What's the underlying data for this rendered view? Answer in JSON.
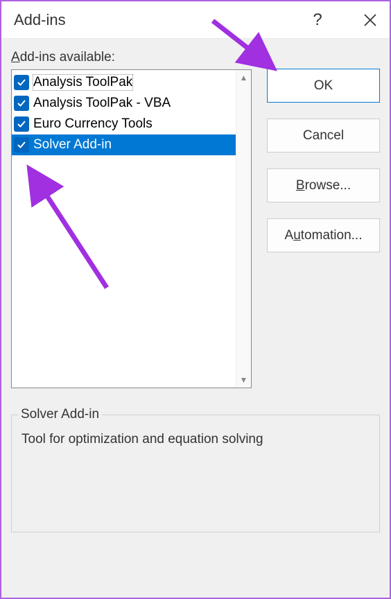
{
  "dialog": {
    "title": "Add-ins",
    "list_label_prefix": "A",
    "list_label_rest": "dd-ins available:",
    "items": [
      {
        "label": "Analysis ToolPak",
        "checked": true,
        "selected": false,
        "first": true
      },
      {
        "label": "Analysis ToolPak - VBA",
        "checked": true,
        "selected": false
      },
      {
        "label": "Euro Currency Tools",
        "checked": true,
        "selected": false
      },
      {
        "label": "Solver Add-in",
        "checked": true,
        "selected": true
      }
    ],
    "buttons": {
      "ok": "OK",
      "cancel": "Cancel",
      "browse_u": "B",
      "browse_rest": "rowse...",
      "automation_pre": "A",
      "automation_u": "u",
      "automation_rest": "tomation..."
    },
    "groupbox": {
      "title": "Solver Add-in",
      "description": "Tool for optimization and equation solving"
    }
  }
}
